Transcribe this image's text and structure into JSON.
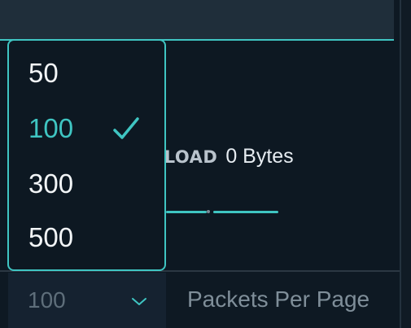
{
  "payload": {
    "label": "YLOAD",
    "value": "0 Bytes"
  },
  "page_size": {
    "selected": "100",
    "options": [
      "50",
      "100",
      "300",
      "500"
    ],
    "selected_index": 1,
    "label": "Packets Per Page"
  },
  "icons": {
    "check": "checkmark-icon",
    "chevron": "chevron-down-icon"
  },
  "colors": {
    "accent": "#3fc5c2",
    "background": "#0d1822",
    "text": "#f2f5f7",
    "muted": "#7f8e99"
  }
}
